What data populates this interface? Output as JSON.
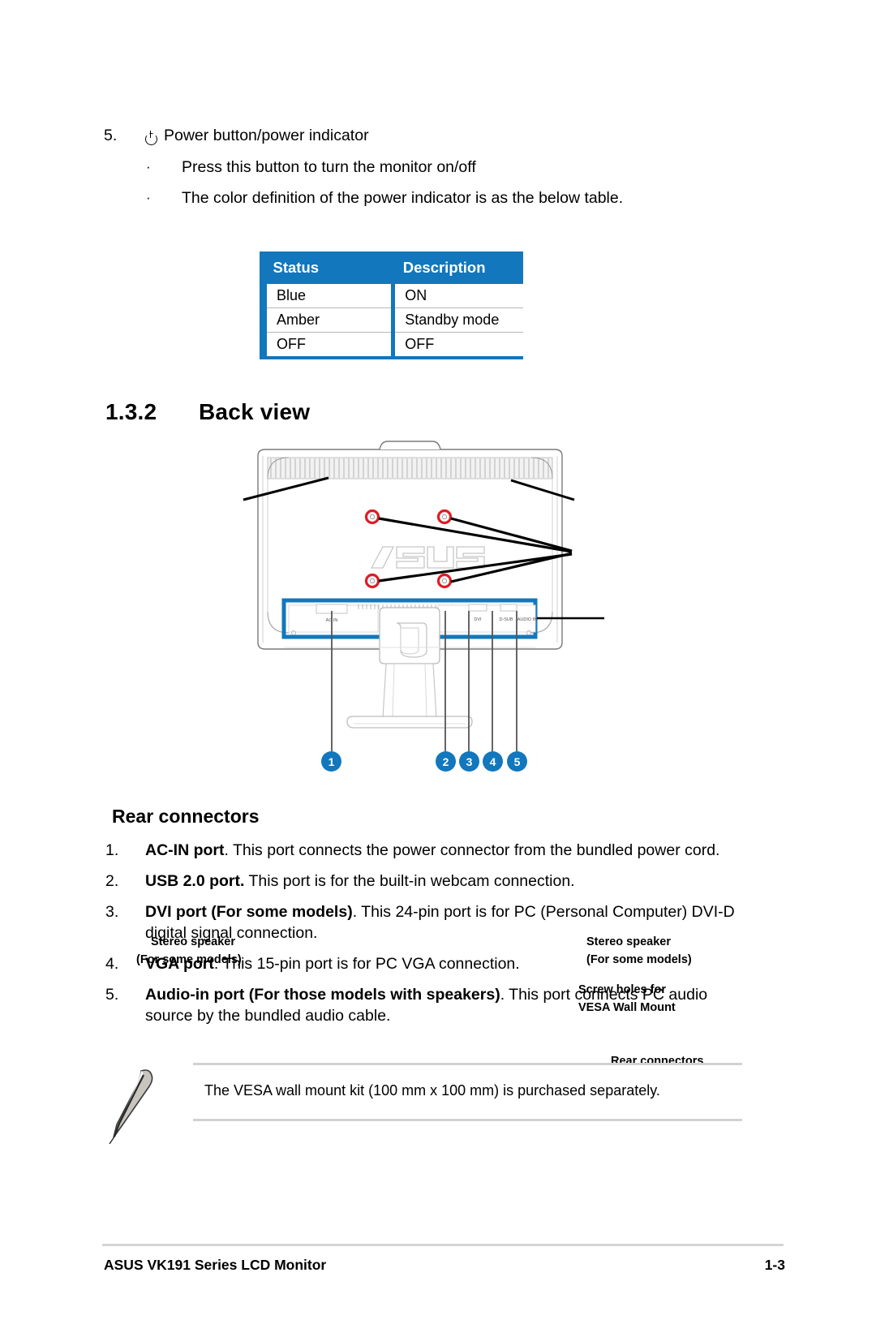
{
  "item5": {
    "number": "5.",
    "power_icon": "power-icon",
    "title": "Power button/power indicator",
    "bullet_char": "·",
    "bullets": [
      "Press this button to turn the monitor on/off",
      "The color definition of the power indicator is as the below table."
    ]
  },
  "status_table": {
    "headers": [
      "Status",
      "Description"
    ],
    "rows": [
      [
        "Blue",
        "ON"
      ],
      [
        "Amber",
        "Standby mode"
      ],
      [
        "OFF",
        "OFF"
      ]
    ],
    "accent_color": "#1277bc"
  },
  "section": {
    "number": "1.3.2",
    "title": "Back view"
  },
  "figure": {
    "labels": {
      "speaker_left_line1": "Stereo speaker",
      "speaker_left_line2": "(For some models)",
      "speaker_right_line1": "Stereo speaker",
      "speaker_right_line2": "(For some models)",
      "vesa_line1": "Screw holes for",
      "vesa_line2": "VESA Wall Mount",
      "rear_connectors": "Rear connectors"
    },
    "port_texts": [
      "AC IN",
      "DVI",
      "D-SUB",
      "AUDIO IN"
    ],
    "brand": "ASUS",
    "callouts": [
      "1",
      "2",
      "3",
      "4",
      "5"
    ],
    "highlight_color": "#1277bc",
    "screw_color": "#e01b24"
  },
  "rear_connectors": {
    "heading": "Rear connectors",
    "items": [
      {
        "number": "1.",
        "bold": "AC-IN port",
        "text": ". This port connects the power connector from the bundled power cord."
      },
      {
        "number": "2.",
        "bold": "USB 2.0 port.",
        "text": " This port is for the built-in webcam connection."
      },
      {
        "number": "3.",
        "bold": "DVI port (For some models)",
        "text": ". This 24-pin port is for PC (Personal Computer) DVI-D digital signal connection."
      },
      {
        "number": "4.",
        "bold": "VGA port",
        "text": ". This 15-pin port is for PC VGA connection."
      },
      {
        "number": "5.",
        "bold": "Audio-in port (For those models with speakers)",
        "text": ". This port connects PC audio source by the bundled audio cable."
      }
    ]
  },
  "note": {
    "icon": "note-pen-icon",
    "text": "The VESA wall mount kit (100 mm x 100 mm) is purchased separately."
  },
  "footer": {
    "left": "ASUS VK191 Series LCD Monitor",
    "right": "1-3"
  }
}
